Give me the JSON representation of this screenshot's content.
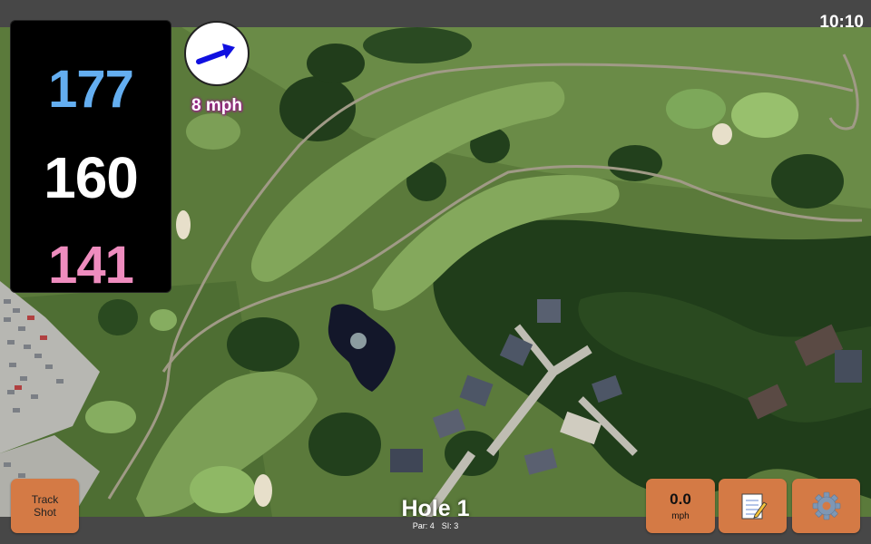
{
  "status": {
    "time": "10:10"
  },
  "yardages": {
    "back": "177",
    "middle": "160",
    "front": "141"
  },
  "wind": {
    "speed": "8 mph",
    "icon": "wind-direction-arrow-icon"
  },
  "hole": {
    "title": "Hole 1",
    "par": "Par: 4",
    "si": "SI: 3"
  },
  "buttons": {
    "track_shot": {
      "line1": "Track",
      "line2": "Shot"
    },
    "speed": {
      "value": "0.0",
      "unit": "mph"
    },
    "notes": {
      "icon": "notepad-icon"
    },
    "settings": {
      "icon": "gear-icon"
    }
  },
  "colors": {
    "back_yardage": "#64aef0",
    "middle_yardage": "#ffffff",
    "front_yardage": "#ee8cbe",
    "button": "#d47a45",
    "bar": "#474747"
  }
}
